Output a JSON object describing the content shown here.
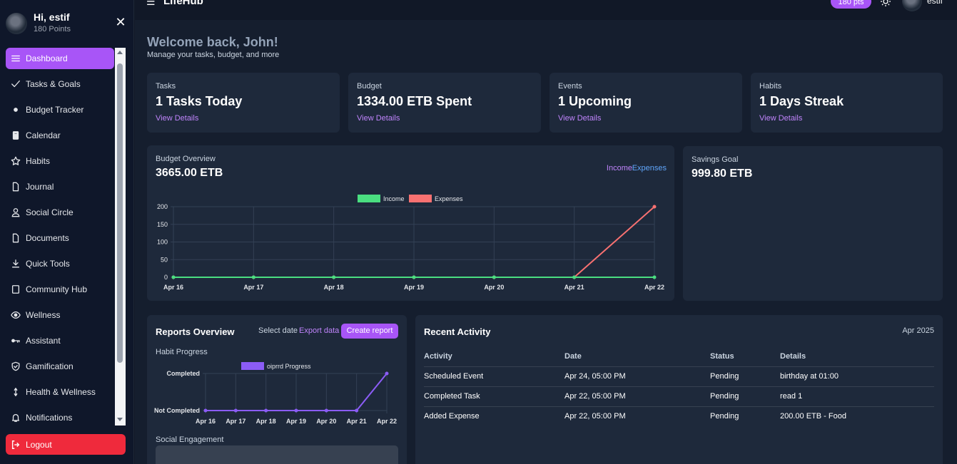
{
  "sidebar": {
    "user_name": "Hi, estif",
    "points": "180 Points",
    "items": [
      {
        "label": "Dashboard",
        "icon": "menu-icon"
      },
      {
        "label": "Tasks & Goals",
        "icon": "check-icon"
      },
      {
        "label": "Budget Tracker",
        "icon": "dot-icon"
      },
      {
        "label": "Calendar",
        "icon": "calendar-icon"
      },
      {
        "label": "Habits",
        "icon": "star-icon"
      },
      {
        "label": "Journal",
        "icon": "file-icon"
      },
      {
        "label": "Social Circle",
        "icon": "user-icon"
      },
      {
        "label": "Documents",
        "icon": "document-icon"
      },
      {
        "label": "Quick Tools",
        "icon": "download-icon"
      },
      {
        "label": "Community Hub",
        "icon": "square-icon"
      },
      {
        "label": "Wellness",
        "icon": "eye-icon"
      },
      {
        "label": "Assistant",
        "icon": "key-icon"
      },
      {
        "label": "Gamification",
        "icon": "shield-icon"
      },
      {
        "label": "Health & Wellness",
        "icon": "pulse-icon"
      },
      {
        "label": "Notifications",
        "icon": "bell-icon"
      }
    ],
    "logout_label": "Logout",
    "accent": "#a855f7",
    "logout_color": "#ef2a3c"
  },
  "topbar": {
    "title": "LifeHub",
    "points_badge": "180 pts",
    "user": "estif"
  },
  "welcome": {
    "title": "Welcome back, John!",
    "subtitle": "Manage your tasks, budget, and more"
  },
  "stats": [
    {
      "label": "Tasks",
      "value": "1 Tasks Today",
      "link": "View Details"
    },
    {
      "label": "Budget",
      "value": "1334.00 ETB Spent",
      "link": "View Details"
    },
    {
      "label": "Events",
      "value": "1 Upcoming",
      "link": "View Details"
    },
    {
      "label": "Habits",
      "value": "1 Days Streak",
      "link": "View Details"
    }
  ],
  "budget_overview": {
    "label": "Budget Overview",
    "value": "3665.00 ETB",
    "income_link": "Income",
    "expenses_link": "Expenses"
  },
  "savings": {
    "label": "Savings Goal",
    "value": "999.80 ETB"
  },
  "reports": {
    "title": "Reports Overview",
    "select_date": "Select date",
    "export": "Export data",
    "create": "Create report",
    "habit_label": "Habit Progress",
    "social_label": "Social Engagement"
  },
  "activity": {
    "title": "Recent Activity",
    "month": "Apr 2025",
    "headers": [
      "Activity",
      "Date",
      "Status",
      "Details"
    ],
    "rows": [
      [
        "Scheduled Event",
        "Apr 24, 05:00 PM",
        "Pending",
        "birthday at 01:00"
      ],
      [
        "Completed Task",
        "Apr 22, 05:00 PM",
        "Pending",
        "read 1"
      ],
      [
        "Added Expense",
        "Apr 22, 05:00 PM",
        "Pending",
        "200.00 ETB - Food"
      ]
    ]
  },
  "chart_data": [
    {
      "type": "line",
      "x": [
        "Apr 16",
        "Apr 17",
        "Apr 18",
        "Apr 19",
        "Apr 20",
        "Apr 21",
        "Apr 22"
      ],
      "ylim": [
        0,
        200
      ],
      "yticks": [
        0,
        50,
        100,
        150,
        200
      ],
      "legend_position": "top",
      "series": [
        {
          "name": "Income",
          "color": "#4ade80",
          "values": [
            0,
            0,
            0,
            0,
            0,
            0,
            0
          ]
        },
        {
          "name": "Expenses",
          "color": "#f87171",
          "values": [
            0,
            0,
            0,
            0,
            0,
            0,
            200
          ]
        }
      ]
    },
    {
      "type": "line",
      "x": [
        "Apr 16",
        "Apr 17",
        "Apr 18",
        "Apr 19",
        "Apr 20",
        "Apr 21",
        "Apr 22"
      ],
      "ycategories": [
        "Not Completed",
        "Completed"
      ],
      "legend_position": "top",
      "series": [
        {
          "name": "oiprrd Progress",
          "color": "#8b5cf6",
          "values": [
            0,
            0,
            0,
            0,
            0,
            0,
            1
          ]
        }
      ]
    }
  ]
}
